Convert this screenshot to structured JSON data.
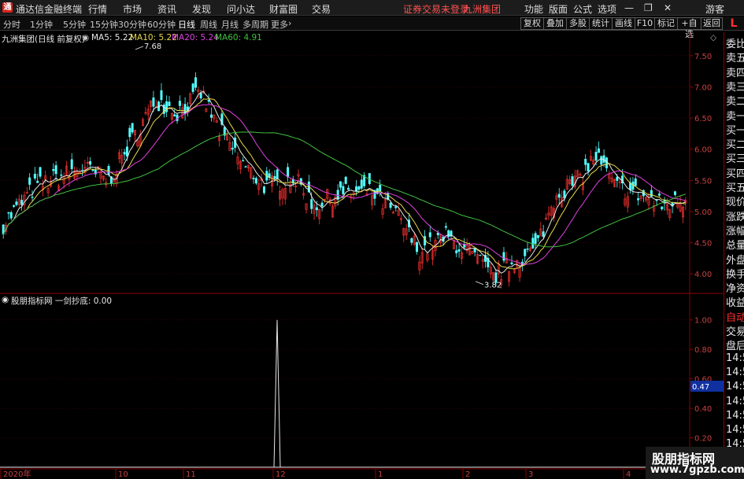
{
  "app": {
    "title": "通达信金融终端",
    "logo_char": "通"
  },
  "menu": {
    "items": [
      "行情",
      "市场",
      "资讯",
      "发现",
      "问小达",
      "财富圈",
      "交易"
    ],
    "notice": "证券交易未登录",
    "stock_name": "九洲集团",
    "right_items": [
      "功能",
      "版面",
      "公式",
      "选项"
    ],
    "user": "游客"
  },
  "toolbar": {
    "periods": [
      "分时",
      "1分钟",
      "5分钟",
      "15分钟",
      "30分钟",
      "60分钟",
      "日线",
      "周线",
      "月线",
      "多周期",
      "更多"
    ],
    "active_period": "日线",
    "buttons": [
      "复权",
      "叠加",
      "多股",
      "统计",
      "画线",
      "F10",
      "标记",
      "+自选",
      "返回"
    ],
    "l_label": "L"
  },
  "main_chart": {
    "title": "九洲集团(日线 前复权)",
    "ma_labels": [
      {
        "text": "MA5: 5.22",
        "color": "#e8e8e8"
      },
      {
        "text": "MA10: 5.22",
        "color": "#e8d84a"
      },
      {
        "text": "MA20: 5.24",
        "color": "#e040e0"
      },
      {
        "text": "MA60: 4.91",
        "color": "#40c040"
      }
    ],
    "high_label": "7.68",
    "low_label": "3.82",
    "y_ticks": [
      "7.50",
      "7.00",
      "6.50",
      "6.00",
      "5.50",
      "5.00",
      "4.50",
      "4.00"
    ]
  },
  "sub_chart": {
    "title": "股朋指标网 一剑抄底: 0.00",
    "y_ticks": [
      "1.00",
      "0.80",
      "0.60",
      "0.40",
      "0.20"
    ],
    "current_value": "0.47"
  },
  "x_axis": {
    "labels": [
      "2020年",
      "10",
      "11",
      "12",
      "1",
      "2",
      "3",
      "4"
    ]
  },
  "sidebar": {
    "items": [
      "委比",
      "卖五",
      "卖四",
      "卖三",
      "卖二",
      "卖一",
      "买一",
      "买二",
      "买三",
      "买四",
      "买五",
      "现价",
      "涨跌",
      "涨幅",
      "总量",
      "外盘",
      "换手",
      "净资",
      "收益",
      "自动",
      "交易",
      "盘后",
      "14:56",
      "14:56",
      "14:56",
      "14:56",
      "14:56",
      "14:56",
      "14:56",
      "14:56"
    ]
  },
  "watermark": {
    "line1": "股朋指标网",
    "line2": "www.7gpzb.com"
  },
  "colors": {
    "up": "#ff3232",
    "down": "#54ffff",
    "ma5": "#e8e8e8",
    "ma10": "#e8d84a",
    "ma20": "#e040e0",
    "ma60": "#40c040",
    "axis": "#8b0000"
  },
  "chart_data": {
    "type": "candlestick",
    "price_range": [
      3.7,
      7.7
    ],
    "signal_range": [
      0,
      1.1
    ],
    "signal_spike_value": 1.0,
    "ma_last": {
      "ma5": 5.22,
      "ma10": 5.22,
      "ma20": 5.24,
      "ma60": 4.91
    }
  }
}
